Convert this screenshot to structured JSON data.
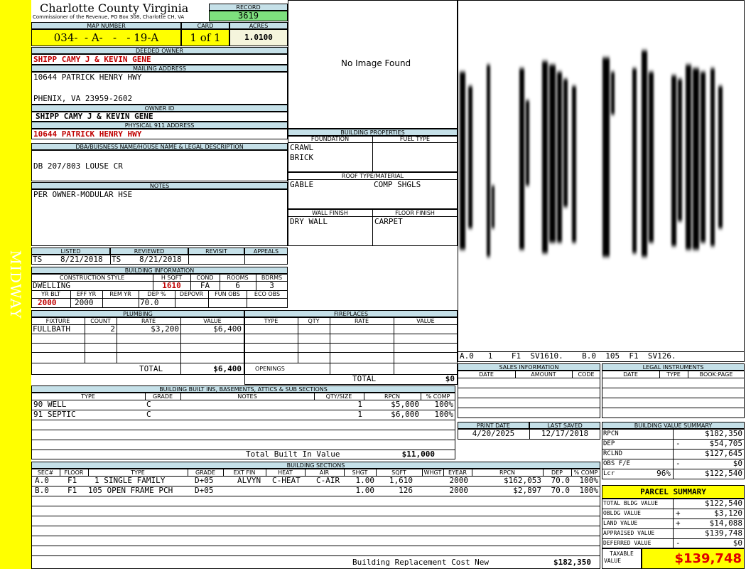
{
  "side_label": "MIDWAY",
  "county": "Charlotte County Virginia",
  "commissioner": "Commissioner of the Revenue, PO Box 308, Charlotte CH, VA",
  "record": {
    "label": "RECORD",
    "value": "3619"
  },
  "map_number": {
    "label": "MAP NUMBER",
    "value": "034-  - A-   -   - 19-A"
  },
  "card": {
    "label": "CARD",
    "value": "1 of 1"
  },
  "acres": {
    "label": "ACRES",
    "value": "1.0100"
  },
  "deeded_owner": {
    "label": "DEEDED OWNER",
    "value": "SHIPP CAMY J & KEVIN GENE"
  },
  "mailing_address": {
    "label": "MAILING ADDRESS",
    "line1": "10644 PATRICK HENRY HWY",
    "line2": "PHENIX, VA 23959-2602"
  },
  "owner_id": {
    "label": "OWNER ID",
    "value": "SHIPP CAMY J & KEVIN GENE"
  },
  "physical_address": {
    "label": "PHYSICAL 911 ADDRESS",
    "value": "10644 PATRICK HENRY HWY"
  },
  "legal_desc": {
    "label": "DBA/BUISNESS NAME/HOUSE NAME & LEGAL DESCRIPTION",
    "value": "DB 207/803 LOUSE CR"
  },
  "notes": {
    "label": "NOTES",
    "value": "PER OWNER-MODULAR HSE"
  },
  "photo": {
    "text": "No Image Found"
  },
  "sketch": {
    "caption": "A.0   1    F1  SV1610.    B.0  105  F1  SV126.",
    "colors": {
      "ink": "#000000"
    }
  },
  "listed": {
    "label": "LISTED",
    "who": "TS",
    "date": "8/21/2018"
  },
  "reviewed": {
    "label": "REVIEWED",
    "who": "TS",
    "date": "8/21/2018"
  },
  "revisit": {
    "label": "REVISIT"
  },
  "appeals": {
    "label": "APPEALS"
  },
  "building_info": {
    "label": "BUILDING INFORMATION",
    "h_style": "CONSTRUCTION STYLE",
    "h_sqft": "H SQFT",
    "h_cond": "COND",
    "h_rooms": "ROOMS",
    "h_bdrms": "BDRMS",
    "style": "DWELLING",
    "sqft": "1610",
    "cond": "FA",
    "rooms": "6",
    "bdrms": "3",
    "h_yrblt": "YR BLT",
    "h_effyr": "EFF YR",
    "h_remyr": "REM YR",
    "h_dep": "DEP %",
    "h_depovr": "DEPOVR",
    "h_funobs": "FUN OBS",
    "h_ecoobs": "ECO OBS",
    "yrblt": "2000",
    "effyr": "2000",
    "dep": "70.0"
  },
  "building_properties": {
    "label": "BUILDING PROPERTIES",
    "foundation_label": "FOUNDATION",
    "foundation": [
      "CRAWL",
      "BRICK"
    ],
    "fuel_label": "FUEL TYPE",
    "roof_label": "ROOF TYPE/MATERIAL",
    "roof_type": "GABLE",
    "roof_material": "COMP SHGLS",
    "wall_label": "WALL FINISH",
    "wall": "DRY WALL",
    "floor_label": "FLOOR FINISH",
    "floor": "CARPET"
  },
  "plumbing": {
    "label": "PLUMBING",
    "headers": [
      "FIXTURE",
      "COUNT",
      "RATE",
      "VALUE"
    ],
    "rows": [
      {
        "fixture": "FULLBATH",
        "count": "2",
        "rate": "$3,200",
        "value": "$6,400"
      }
    ],
    "total_label": "TOTAL",
    "total": "$6,400"
  },
  "fireplaces": {
    "label": "FIREPLACES",
    "headers": [
      "TYPE",
      "QTY",
      "RATE",
      "VALUE"
    ],
    "openings_label": "OPENINGS",
    "total_label": "TOTAL",
    "total": "$0"
  },
  "built_ins": {
    "label": "BUILDING BUILT INS, BASEMENTS, ATTICS & SUB SECTIONS",
    "headers": [
      "TYPE",
      "GRADE",
      "NOTES",
      "QTY/SIZE",
      "RPCN",
      "% COMP"
    ],
    "rows": [
      {
        "type": "90 WELL",
        "grade": "C",
        "notes": "",
        "qty": "1",
        "rpcn": "$5,000",
        "comp": "100%"
      },
      {
        "type": "91 SEPTIC",
        "grade": "C",
        "notes": "",
        "qty": "1",
        "rpcn": "$6,000",
        "comp": "100%"
      }
    ],
    "total_label": "Total Built In Value",
    "total": "$11,000"
  },
  "sales": {
    "label": "SALES INFORMATION",
    "headers": [
      "DATE",
      "AMOUNT",
      "CODE"
    ]
  },
  "legal_instruments": {
    "label": "LEGAL INSTRUMENTS",
    "headers": [
      "DATE",
      "TYPE",
      "BOOK:PAGE"
    ]
  },
  "print_date": {
    "label": "PRINT DATE",
    "value": "4/20/2025"
  },
  "last_saved": {
    "label": "LAST SAVED",
    "value": "12/17/2018"
  },
  "value_summary": {
    "label": "BUILDING VALUE SUMMARY",
    "rows": [
      {
        "label": "RPCN",
        "sign": "",
        "pct": "",
        "value": "$182,350"
      },
      {
        "label": "DEP",
        "sign": "-",
        "pct": "",
        "value": "$54,705"
      },
      {
        "label": "RCLND",
        "sign": "",
        "pct": "",
        "value": "$127,645"
      },
      {
        "label": "OBS F/E",
        "sign": "-",
        "pct": "",
        "value": "$0"
      },
      {
        "label": "Lcr",
        "sign": "",
        "pct": "96%",
        "value": "$122,540"
      }
    ]
  },
  "building_sections": {
    "label": "BUILDING SECTIONS",
    "headers": [
      "SEC#",
      "FLOOR",
      "TYPE",
      "GRADE",
      "EXT FIN",
      "HEAT",
      "AIR",
      "SHGT",
      "SQFT",
      "WHGT",
      "EYEAR",
      "RPCN",
      "DEP",
      "% COMP"
    ],
    "rows": [
      {
        "sec": "A.0",
        "floor": "F1",
        "type": "1 SINGLE FAMILY",
        "grade": "D+05",
        "extfin": "ALVYN",
        "heat": "C-HEAT",
        "air": "C-AIR",
        "shgt": "1.00",
        "sqft": "1,610",
        "whgt": "",
        "eyear": "2000",
        "rpcn": "$162,053",
        "dep": "70.0",
        "comp": "100%"
      },
      {
        "sec": "B.0",
        "floor": "F1",
        "type": "105 OPEN FRAME PCH",
        "grade": "D+05",
        "extfin": "",
        "heat": "",
        "air": "",
        "shgt": "1.00",
        "sqft": "126",
        "whgt": "",
        "eyear": "2000",
        "rpcn": "$2,897",
        "dep": "70.0",
        "comp": "100%"
      }
    ],
    "total_label": "Building Replacement Cost New",
    "total": "$182,350"
  },
  "parcel_summary": {
    "label": "PARCEL SUMMARY",
    "rows": [
      {
        "label": "TOTAL BLDG VALUE",
        "sign": "",
        "value": "$122,540"
      },
      {
        "label": "OBLDG VALUE",
        "sign": "+",
        "value": "$3,120"
      },
      {
        "label": "LAND VALUE",
        "sign": "+",
        "value": "$14,088"
      },
      {
        "label": "APPRAISED VALUE",
        "sign": "",
        "value": "$139,748"
      },
      {
        "label": "DEFERRED VALUE",
        "sign": "-",
        "value": "$0"
      }
    ],
    "taxable_label_1": "TAXABLE",
    "taxable_label_2": "VALUE",
    "taxable": "$139,748"
  },
  "colors": {
    "side_bar": "#ffff00",
    "header_bg": "#c5e0e8",
    "record_bg": "#7ee07e",
    "red_text": "#c00000",
    "parcel_bg": "#ffff00"
  }
}
